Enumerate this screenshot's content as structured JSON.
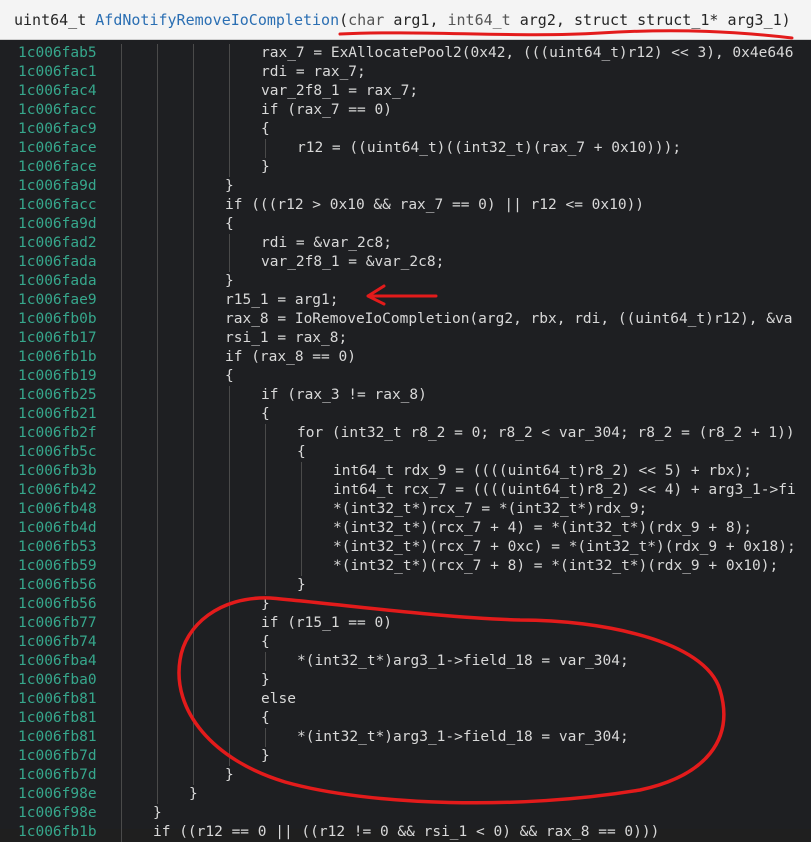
{
  "header": {
    "return_type": "uint64_t",
    "function_name": "AfdNotifyRemoveIoCompletion",
    "open_paren": "(",
    "params": [
      {
        "type": "char",
        "name": "arg1"
      },
      {
        "type": "int64_t",
        "name": "arg2"
      },
      {
        "type": "struct struct_1*",
        "name": "arg3_1"
      }
    ],
    "close_paren": ")"
  },
  "code": {
    "lines": [
      {
        "addr": "1c006fab5",
        "indent": 4,
        "text": "rax_7 = ExAllocatePool2(0x42, (((uint64_t)r12) << 3), 0x4e646"
      },
      {
        "addr": "1c006fac1",
        "indent": 4,
        "text": "rdi = rax_7;"
      },
      {
        "addr": "1c006fac4",
        "indent": 4,
        "text": "var_2f8_1 = rax_7;"
      },
      {
        "addr": "1c006facc",
        "indent": 4,
        "text": "if (rax_7 == 0)"
      },
      {
        "addr": "1c006fac9",
        "indent": 4,
        "text": "{"
      },
      {
        "addr": "1c006face",
        "indent": 5,
        "text": "r12 = ((uint64_t)((int32_t)(rax_7 + 0x10)));"
      },
      {
        "addr": "1c006face",
        "indent": 4,
        "text": "}"
      },
      {
        "addr": "1c006fa9d",
        "indent": 3,
        "text": "}"
      },
      {
        "addr": "1c006facc",
        "indent": 3,
        "text": "if (((r12 > 0x10 && rax_7 == 0) || r12 <= 0x10))"
      },
      {
        "addr": "1c006fa9d",
        "indent": 3,
        "text": "{"
      },
      {
        "addr": "1c006fad2",
        "indent": 4,
        "text": "rdi = &var_2c8;"
      },
      {
        "addr": "1c006fada",
        "indent": 4,
        "text": "var_2f8_1 = &var_2c8;"
      },
      {
        "addr": "1c006fada",
        "indent": 3,
        "text": "}"
      },
      {
        "addr": "1c006fae9",
        "indent": 3,
        "text": "r15_1 = arg1;"
      },
      {
        "addr": "1c006fb0b",
        "indent": 3,
        "text": "rax_8 = IoRemoveIoCompletion(arg2, rbx, rdi, ((uint64_t)r12), &va"
      },
      {
        "addr": "1c006fb17",
        "indent": 3,
        "text": "rsi_1 = rax_8;"
      },
      {
        "addr": "1c006fb1b",
        "indent": 3,
        "text": "if (rax_8 == 0)"
      },
      {
        "addr": "1c006fb19",
        "indent": 3,
        "text": "{"
      },
      {
        "addr": "1c006fb25",
        "indent": 4,
        "text": "if (rax_3 != rax_8)"
      },
      {
        "addr": "1c006fb21",
        "indent": 4,
        "text": "{"
      },
      {
        "addr": "1c006fb2f",
        "indent": 5,
        "text": "for (int32_t r8_2 = 0; r8_2 < var_304; r8_2 = (r8_2 + 1))"
      },
      {
        "addr": "1c006fb5c",
        "indent": 5,
        "text": "{"
      },
      {
        "addr": "1c006fb3b",
        "indent": 6,
        "text": "int64_t rdx_9 = ((((uint64_t)r8_2) << 5) + rbx);"
      },
      {
        "addr": "1c006fb42",
        "indent": 6,
        "text": "int64_t rcx_7 = ((((uint64_t)r8_2) << 4) + arg3_1->fi"
      },
      {
        "addr": "1c006fb48",
        "indent": 6,
        "text": "*(int32_t*)rcx_7 = *(int32_t*)rdx_9;"
      },
      {
        "addr": "1c006fb4d",
        "indent": 6,
        "text": "*(int32_t*)(rcx_7 + 4) = *(int32_t*)(rdx_9 + 8);"
      },
      {
        "addr": "1c006fb53",
        "indent": 6,
        "text": "*(int32_t*)(rcx_7 + 0xc) = *(int32_t*)(rdx_9 + 0x18);"
      },
      {
        "addr": "1c006fb59",
        "indent": 6,
        "text": "*(int32_t*)(rcx_7 + 8) = *(int32_t*)(rdx_9 + 0x10);"
      },
      {
        "addr": "1c006fb56",
        "indent": 5,
        "text": "}"
      },
      {
        "addr": "1c006fb56",
        "indent": 4,
        "text": "}"
      },
      {
        "addr": "1c006fb77",
        "indent": 4,
        "text": "if (r15_1 == 0)"
      },
      {
        "addr": "1c006fb74",
        "indent": 4,
        "text": "{"
      },
      {
        "addr": "1c006fba4",
        "indent": 5,
        "text": "*(int32_t*)arg3_1->field_18 = var_304;"
      },
      {
        "addr": "1c006fba0",
        "indent": 4,
        "text": "}"
      },
      {
        "addr": "1c006fb81",
        "indent": 4,
        "text": "else"
      },
      {
        "addr": "1c006fb81",
        "indent": 4,
        "text": "{"
      },
      {
        "addr": "1c006fb81",
        "indent": 5,
        "text": "*(int32_t*)arg3_1->field_18 = var_304;"
      },
      {
        "addr": "1c006fb7d",
        "indent": 4,
        "text": "}"
      },
      {
        "addr": "1c006fb7d",
        "indent": 3,
        "text": "}"
      },
      {
        "addr": "1c006f98e",
        "indent": 2,
        "text": "}"
      },
      {
        "addr": "1c006f98e",
        "indent": 1,
        "text": "}"
      },
      {
        "addr": "1c006fb1b",
        "indent": 1,
        "text": "if ((r12 == 0 || ((r12 != 0 && rsi_1 < 0) && rax_8 == 0)))"
      }
    ]
  },
  "colors": {
    "header_bg": "#f4f4f4",
    "code_bg": "#1e1f22",
    "address": "#36a78c",
    "function": "#6fb0ff",
    "type": "#c987ff",
    "annotation_red": "#e31b1b"
  },
  "annotations": {
    "underline": "red-underline-signature",
    "arrow": "red-arrow-pointing-left",
    "circle": "red-ellipse-around-if-else"
  }
}
